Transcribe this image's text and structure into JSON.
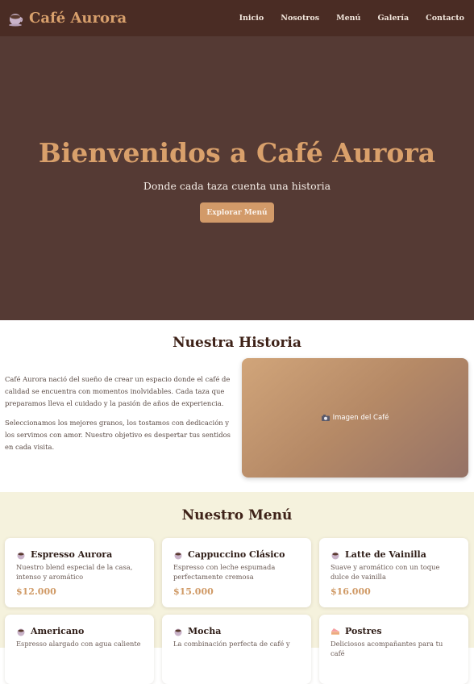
{
  "nav": {
    "brand": "Café Aurora",
    "brand_icon": "coffee-cup-icon",
    "links": [
      "Inicio",
      "Nosotros",
      "Menú",
      "Galería",
      "Contacto"
    ]
  },
  "hero": {
    "title": "Bienvenidos a Café Aurora",
    "subtitle": "Donde cada taza cuenta una historia",
    "button": "Explorar Menú"
  },
  "historia": {
    "title": "Nuestra Historia",
    "paragraphs": [
      "Café Aurora nació del sueño de crear un espacio donde el café de calidad se encuentra con momentos inolvidables. Cada taza que preparamos lleva el cuidado y la pasión de años de experiencia.",
      "Seleccionamos los mejores granos, los tostamos con dedicación y los servimos con amor. Nuestro objetivo es despertar tus sentidos en cada visita."
    ],
    "image_label": "Imagen del Café",
    "image_icon": "camera-icon"
  },
  "menu": {
    "title": "Nuestro Menú",
    "items": [
      {
        "icon": "coffee-cup-icon",
        "name": "Espresso Aurora",
        "desc": "Nuestro blend especial de la casa, intenso y aromático",
        "price": "$12.000"
      },
      {
        "icon": "coffee-cup-icon",
        "name": "Cappuccino Clásico",
        "desc": "Espresso con leche espumada perfectamente cremosa",
        "price": "$15.000"
      },
      {
        "icon": "coffee-cup-icon",
        "name": "Latte de Vainilla",
        "desc": "Suave y aromático con un toque dulce de vainilla",
        "price": "$16.000"
      },
      {
        "icon": "coffee-cup-icon",
        "name": "Americano",
        "desc": "Espresso alargado con agua caliente",
        "price": ""
      },
      {
        "icon": "coffee-cup-icon",
        "name": "Mocha",
        "desc": "La combinación perfecta de café y",
        "price": ""
      },
      {
        "icon": "cake-icon",
        "name": "Postres",
        "desc": "Deliciosos acompañantes para tu café",
        "price": ""
      }
    ]
  },
  "colors": {
    "nav_bg": "#4a2c24",
    "hero_bg": "#553a34",
    "accent": "#d9a06b",
    "menu_bg": "#f5f2dd"
  }
}
